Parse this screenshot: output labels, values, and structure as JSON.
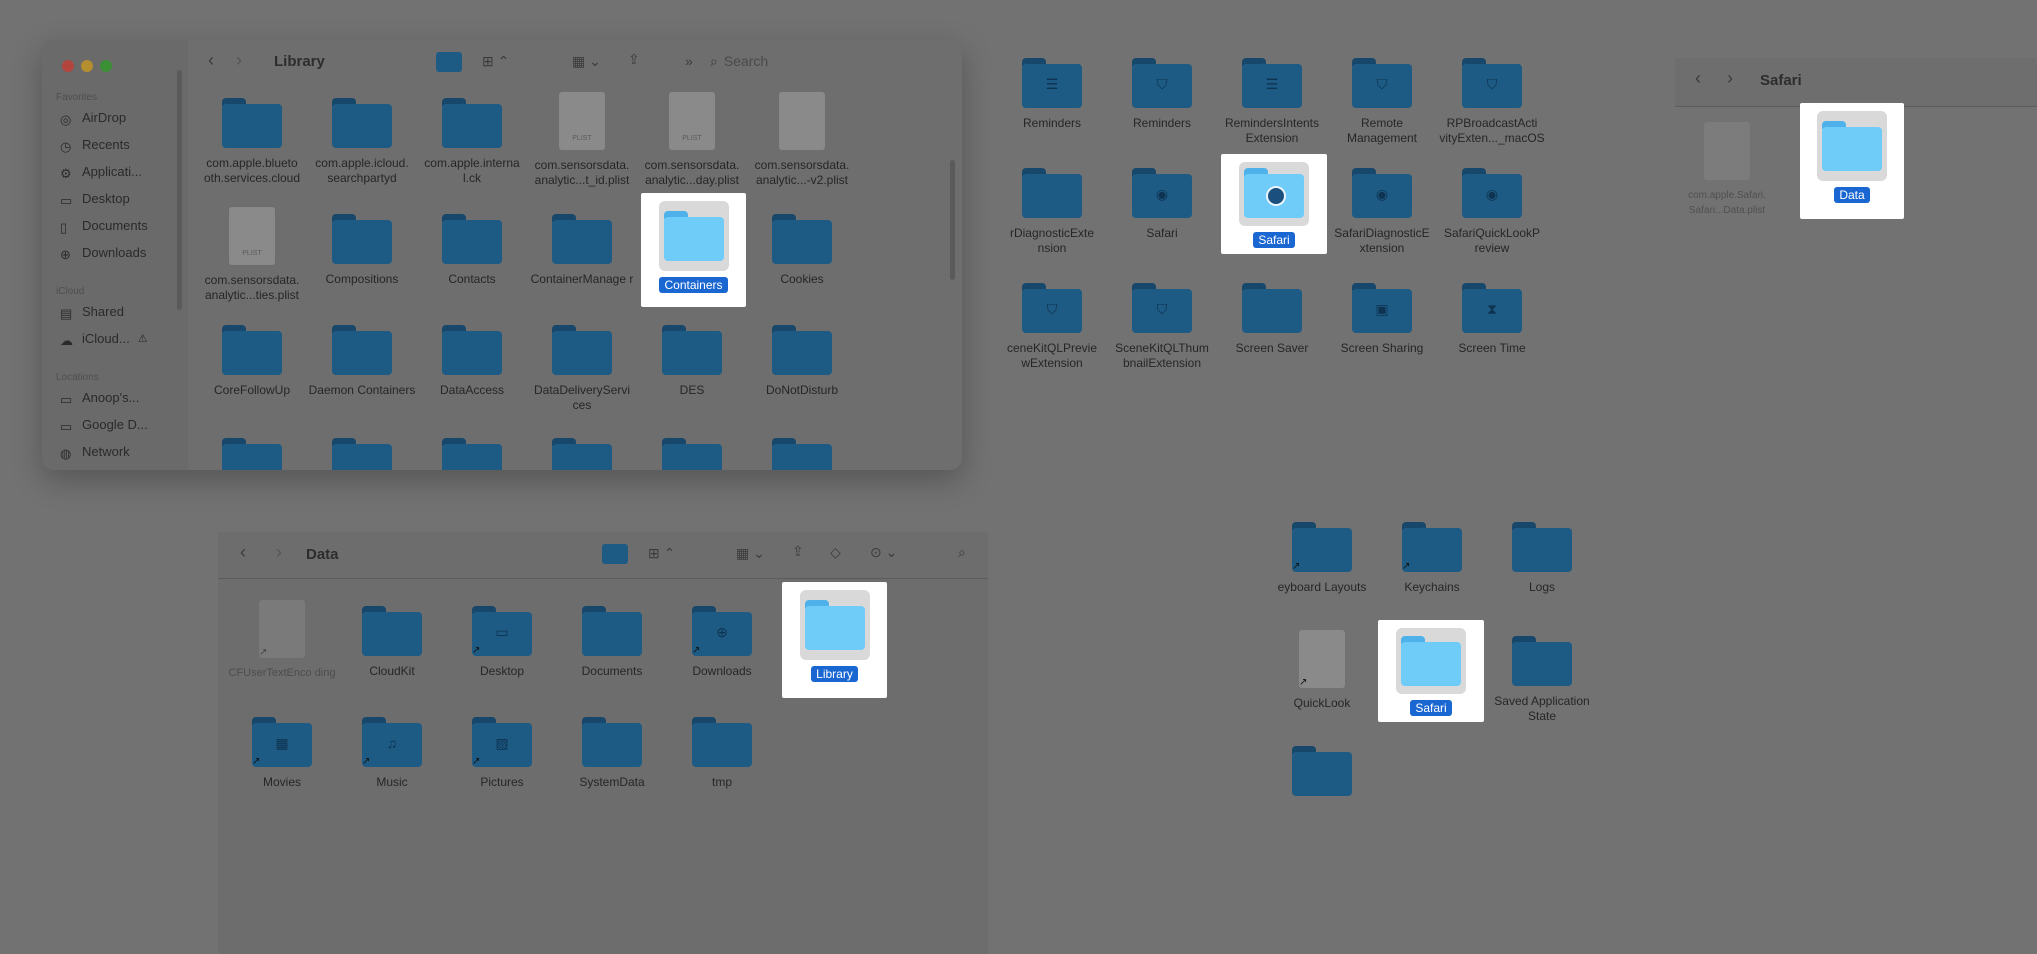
{
  "colors": {
    "overlay": "#727272",
    "folder_dim": "#1d5a84",
    "folder_highlight": "#6fcbf7",
    "selection": "#1a67d2",
    "traffic_close": "#e8574d",
    "traffic_min": "#e5b63a",
    "traffic_max": "#4bbd43"
  },
  "finder1": {
    "title": "Library",
    "search_placeholder": "Search",
    "sidebar": {
      "favorites_label": "Favorites",
      "favorites": [
        {
          "label": "AirDrop",
          "icon": "airdrop-icon"
        },
        {
          "label": "Recents",
          "icon": "clock-icon"
        },
        {
          "label": "Applicati...",
          "icon": "applications-icon"
        },
        {
          "label": "Desktop",
          "icon": "desktop-icon"
        },
        {
          "label": "Documents",
          "icon": "document-icon"
        },
        {
          "label": "Downloads",
          "icon": "download-icon"
        }
      ],
      "icloud_label": "iCloud",
      "icloud": [
        {
          "label": "Shared",
          "icon": "shared-folder-icon"
        },
        {
          "label": "iCloud...",
          "icon": "cloud-icon"
        }
      ],
      "locations_label": "Locations",
      "locations": [
        {
          "label": "Anoop's...",
          "icon": "laptop-icon"
        },
        {
          "label": "Google D...",
          "icon": "drive-icon"
        },
        {
          "label": "Network",
          "icon": "network-icon"
        }
      ]
    },
    "items": [
      {
        "label": "com.apple.blueto oth.services.cloud",
        "kind": "folder"
      },
      {
        "label": "com.apple.icloud. searchpartyd",
        "kind": "folder"
      },
      {
        "label": "com.apple.interna l.ck",
        "kind": "folder"
      },
      {
        "label": "com.sensorsdata. analytic...t_id.plist",
        "kind": "plist"
      },
      {
        "label": "com.sensorsdata. analytic...day.plist",
        "kind": "plist"
      },
      {
        "label": "com.sensorsdata. analytic...-v2.plist",
        "kind": "file"
      },
      {
        "label": "com.sensorsdata. analytic...ties.plist",
        "kind": "plist"
      },
      {
        "label": "Compositions",
        "kind": "folder"
      },
      {
        "label": "Contacts",
        "kind": "folder"
      },
      {
        "label": "ContainerManage r",
        "kind": "folder"
      },
      {
        "label": "Containers",
        "kind": "folder-selected"
      },
      {
        "label": "Cookies",
        "kind": "folder"
      },
      {
        "label": "CoreFollowUp",
        "kind": "folder"
      },
      {
        "label": "Daemon Containers",
        "kind": "folder"
      },
      {
        "label": "DataAccess",
        "kind": "folder"
      },
      {
        "label": "DataDeliveryServi ces",
        "kind": "folder"
      },
      {
        "label": "DES",
        "kind": "folder"
      },
      {
        "label": "DoNotDisturb",
        "kind": "folder"
      }
    ],
    "plist_tag": "PLIST"
  },
  "containers_grid": {
    "items": [
      {
        "label": "Reminders"
      },
      {
        "label": "Reminders"
      },
      {
        "label": "RemindersIntents Extension"
      },
      {
        "label": "Remote Management"
      },
      {
        "label": "RPBroadcastActi vityExten..._macOS"
      },
      {
        "label": "rDiagnosticExte nsion"
      },
      {
        "label": "Safari"
      },
      {
        "label": "Safari"
      },
      {
        "label": "SafariDiagnosticE xtension"
      },
      {
        "label": "SafariQuickLookP review"
      },
      {
        "label": "ceneKitQLPrevie wExtension"
      },
      {
        "label": "SceneKitQLThum bnailExtension"
      },
      {
        "label": "Screen Saver"
      },
      {
        "label": "Screen Sharing"
      },
      {
        "label": "Screen Time"
      }
    ]
  },
  "safari_window": {
    "title": "Safari",
    "faded_file": "com.apple.Safari. Safari...Data.plist",
    "selected": "Data"
  },
  "data_window": {
    "title": "Data",
    "items": [
      {
        "label": "CFUserTextEnco ding",
        "kind": "file"
      },
      {
        "label": "CloudKit",
        "kind": "folder"
      },
      {
        "label": "Desktop",
        "kind": "folder"
      },
      {
        "label": "Documents",
        "kind": "folder"
      },
      {
        "label": "Downloads",
        "kind": "folder"
      },
      {
        "label": "Library",
        "kind": "folder-selected"
      },
      {
        "label": "Movies",
        "kind": "folder"
      },
      {
        "label": "Music",
        "kind": "folder"
      },
      {
        "label": "Pictures",
        "kind": "folder"
      },
      {
        "label": "SystemData",
        "kind": "folder"
      },
      {
        "label": "tmp",
        "kind": "folder"
      }
    ]
  },
  "library_grid": {
    "items": [
      {
        "label": "eyboard Layouts"
      },
      {
        "label": "Keychains"
      },
      {
        "label": "Logs"
      },
      {
        "label": "QuickLook"
      },
      {
        "label": "Safari"
      },
      {
        "label": "Saved Application State"
      }
    ]
  }
}
